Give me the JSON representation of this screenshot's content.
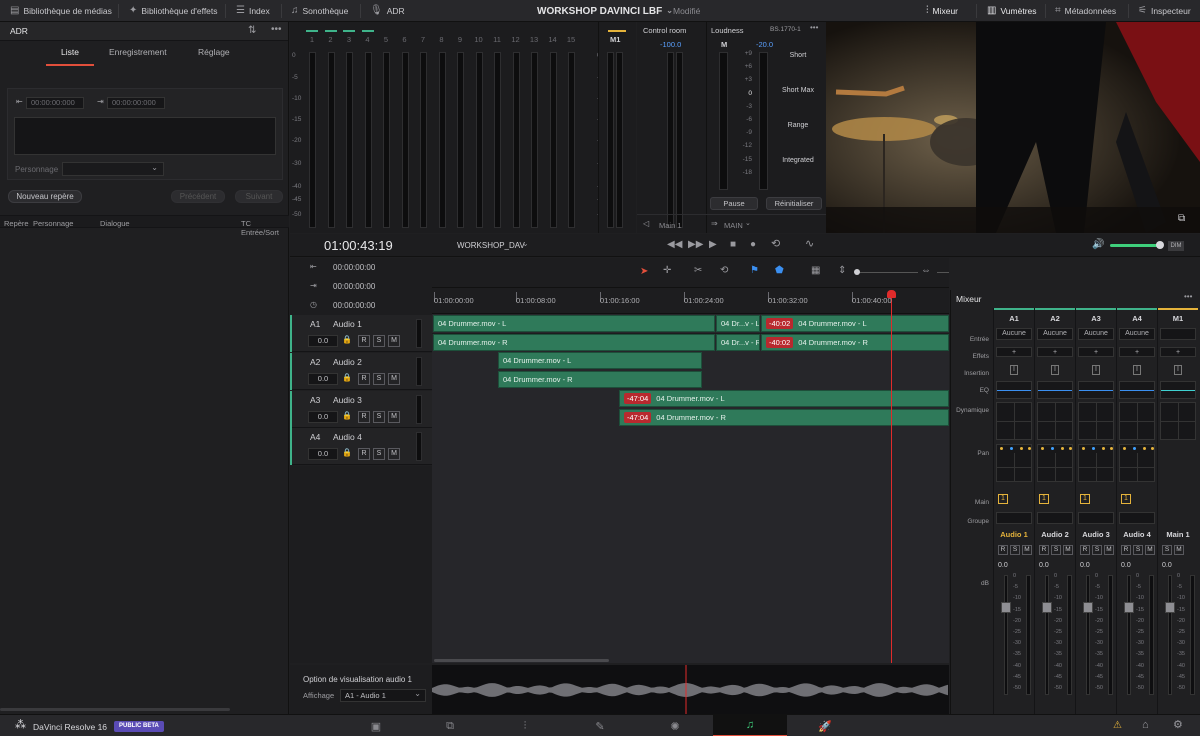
{
  "colors": {
    "accent": "#e24f3b",
    "clip": "#2f7a5a",
    "meter_green": "#3fb38a",
    "badge": "#b8292e",
    "playhead": "#e02b2b"
  },
  "topbar": {
    "media_pool": "Bibliothèque de médias",
    "effects": "Bibliothèque d'effets",
    "index": "Index",
    "sound_library": "Sonothèque",
    "adr": "ADR",
    "project_title": "WORKSHOP DAVINCI LBF",
    "modified": "Modifié",
    "mixer": "Mixeur",
    "meters": "Vumètres",
    "metadata": "Métadonnées",
    "inspector": "Inspecteur"
  },
  "adr_panel": {
    "title": "ADR",
    "tabs": [
      "Liste",
      "Enregistrement",
      "Réglage"
    ],
    "active_tab": "Liste",
    "tc_in": "00:00:00:000",
    "tc_out": "00:00:00:000",
    "character_label": "Personnage",
    "new_marker": "Nouveau repère",
    "previous": "Précédent",
    "next": "Suivant",
    "columns": [
      "Repère",
      "Personnage",
      "Dialogue",
      "TC Entrée/Sort"
    ]
  },
  "meters": {
    "channels": [
      "1",
      "2",
      "3",
      "4",
      "5",
      "6",
      "7",
      "8",
      "9",
      "10",
      "11",
      "12",
      "13",
      "14",
      "15"
    ],
    "scale": [
      "0",
      "-5",
      "-10",
      "-15",
      "-20",
      "-30",
      "-40",
      "-45",
      "-50"
    ],
    "main_label": "M1",
    "control_room": {
      "title": "Control room",
      "value": "-100.0",
      "footer": "Main 1"
    },
    "loudness": {
      "title": "Loudness",
      "standard": "BS.1770-1",
      "m_label": "M",
      "value": "-20.0",
      "scale": [
        "+9",
        "+6",
        "+3",
        "0",
        "-3",
        "-6",
        "-9",
        "-12",
        "-15",
        "-18"
      ],
      "short": "Short",
      "short_max": "Short Max",
      "range": "Range",
      "integrated": "Integrated",
      "pause": "Pause",
      "reset": "Réinitialiser",
      "footer": "MAIN"
    }
  },
  "transport": {
    "timecode": "01:00:43:19",
    "timeline_name": "WORKSHOP_DAV",
    "tc_rows": [
      "00:00:00:00",
      "00:00:00:00",
      "00:00:00:00"
    ]
  },
  "tracks": [
    {
      "id": "A1",
      "name": "Audio 1",
      "volume": "0.0"
    },
    {
      "id": "A2",
      "name": "Audio 2",
      "volume": "0.0"
    },
    {
      "id": "A3",
      "name": "Audio 3",
      "volume": "0.0"
    },
    {
      "id": "A4",
      "name": "Audio 4",
      "volume": "0.0"
    }
  ],
  "ruler": [
    "01:00:00:00",
    "01:00:08:00",
    "01:00:16:00",
    "01:00:24:00",
    "01:00:32:00",
    "01:00:40:00"
  ],
  "clips": {
    "a1_l": "04 Drummer.mov - L",
    "a1_r": "04 Drummer.mov - R",
    "a1_short_l": "04 Dr...v - L",
    "a1_short_r": "04 Dr...v - R",
    "a1b_l": "04 Drummer.mov - L",
    "a1b_r": "04 Drummer.mov - R",
    "a1b_badge": "-40:02",
    "a2_l": "04 Drummer.mov - L",
    "a2_r": "04 Drummer.mov - R",
    "a3_l": "04 Drummer.mov - L",
    "a3_r": "04 Drummer.mov - R",
    "a3_badge": "-47:04"
  },
  "waveform_panel": {
    "title": "Option de visualisation audio 1",
    "display_label": "Affichage",
    "display_value": "A1 - Audio 1"
  },
  "mixer": {
    "title": "Mixeur",
    "channels": [
      "A1",
      "A2",
      "A3",
      "A4",
      "M1"
    ],
    "row_labels": [
      "Entrée",
      "Effets",
      "Insertion",
      "EQ",
      "Dynamique",
      "Pan",
      "Main",
      "Groupe"
    ],
    "input_value": "Aucune",
    "main_value": "1",
    "names": [
      "Audio 1",
      "Audio 2",
      "Audio 3",
      "Audio 4",
      "Main 1"
    ],
    "db_label": "dB",
    "fader_value": "0.0",
    "fader_scale": [
      "0",
      "-5",
      "-10",
      "-15",
      "-20",
      "-25",
      "-30",
      "-35",
      "-40",
      "-45",
      "-50"
    ]
  },
  "bottombar": {
    "app_name": "DaVinci Resolve 16",
    "beta_label": "PUBLIC BETA"
  }
}
